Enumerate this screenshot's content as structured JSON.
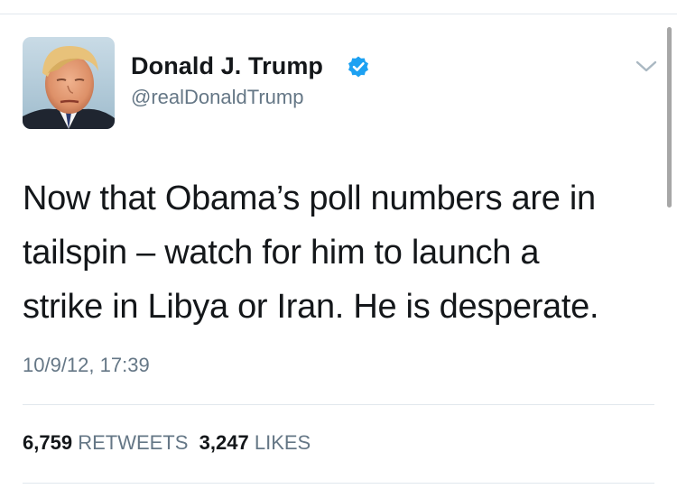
{
  "author": {
    "display_name": "Donald J. Trump",
    "handle": "@realDonaldTrump",
    "verified": true,
    "verified_color": "#1da1f2"
  },
  "tweet": {
    "lines": [
      "Now that Obama’s poll numbers are in",
      "tailspin – watch for him to launch a",
      "strike in Libya or Iran.  He is desperate."
    ],
    "timestamp": "10/9/12, 17:39"
  },
  "stats": {
    "retweets_count": "6,759",
    "retweets_label": "RETWEETS",
    "likes_count": "3,247",
    "likes_label": "LIKES"
  },
  "icons": {
    "menu": "chevron-down-icon",
    "verified": "verified-badge-icon"
  },
  "colors": {
    "text": "#14171a",
    "secondary": "#657786",
    "divider": "#e1e8ed"
  }
}
